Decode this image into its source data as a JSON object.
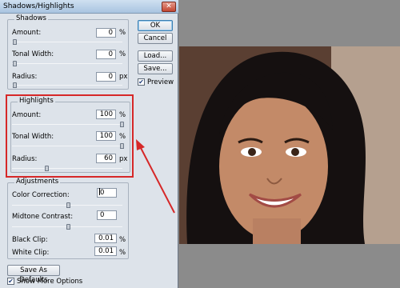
{
  "window": {
    "title": "Shadows/Highlights",
    "close_glyph": "✕"
  },
  "shadows": {
    "legend": "Shadows",
    "amount": {
      "label": "Amount:",
      "value": "0",
      "unit": "%"
    },
    "tonal_width": {
      "label": "Tonal Width:",
      "value": "0",
      "unit": "%"
    },
    "radius": {
      "label": "Radius:",
      "value": "0",
      "unit": "px"
    }
  },
  "highlights": {
    "legend": "Highlights",
    "amount": {
      "label": "Amount:",
      "value": "100",
      "unit": "%"
    },
    "tonal_width": {
      "label": "Tonal Width:",
      "value": "100",
      "unit": "%"
    },
    "radius": {
      "label": "Radius:",
      "value": "60",
      "unit": "px"
    }
  },
  "adjustments": {
    "legend": "Adjustments",
    "color_correction": {
      "label": "Color Correction:",
      "value": "0"
    },
    "midtone_contrast": {
      "label": "Midtone Contrast:",
      "value": "0"
    },
    "black_clip": {
      "label": "Black Clip:",
      "value": "0.01",
      "unit": "%"
    },
    "white_clip": {
      "label": "White Clip:",
      "value": "0.01",
      "unit": "%"
    }
  },
  "buttons": {
    "ok": "OK",
    "cancel": "Cancel",
    "load": "Load...",
    "save": "Save...",
    "save_defaults": "Save As Defaults"
  },
  "options": {
    "preview": {
      "label": "Preview",
      "checked": true
    },
    "show_more": {
      "label": "Show More Options",
      "checked": true
    },
    "check_glyph": "✔"
  },
  "colors": {
    "annotation": "#d62828",
    "dialog_bg": "#dde3ea",
    "canvas_bg": "#8b8b8b"
  }
}
